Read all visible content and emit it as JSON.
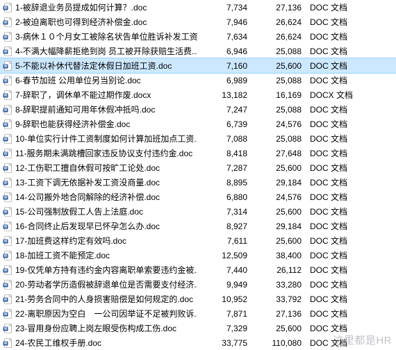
{
  "watermark": "这里都是HR",
  "rows": [
    {
      "icon": "doc",
      "name": "1-被辞退业务员提成如何计算？.doc",
      "val": "7,734",
      "size": "27,136",
      "type": "DOC 文档",
      "selected": false
    },
    {
      "icon": "doc",
      "name": "2-被迫离职也可得到经济补偿金.doc",
      "val": "7,946",
      "size": "26,624",
      "type": "DOC 文档",
      "selected": false
    },
    {
      "icon": "doc",
      "name": "3-病休１０个月女工被除名状告单位胜诉补发工资...",
      "val": "7,634",
      "size": "26,624",
      "type": "DOC 文档",
      "selected": false
    },
    {
      "icon": "doc",
      "name": "4-不满大幅降薪拒绝到岗 员工被开除获赔生活费....",
      "val": "6,946",
      "size": "25,088",
      "type": "DOC 文档",
      "selected": false
    },
    {
      "icon": "doc",
      "name": "5-不能以补休代替法定休假日加班工资.doc",
      "val": "7,160",
      "size": "25,600",
      "type": "DOC 文档",
      "selected": true
    },
    {
      "icon": "doc",
      "name": "6-春节加班 公用单位另当别论.doc",
      "val": "6,989",
      "size": "25,088",
      "type": "DOC 文档",
      "selected": false
    },
    {
      "icon": "docx",
      "name": "7-辞职了，调休单不能过期作废.docx",
      "val": "13,182",
      "size": "16,169",
      "type": "DOCX 文档",
      "selected": false
    },
    {
      "icon": "doc",
      "name": "8-辞职提前通知可用年休假冲抵吗.doc",
      "val": "7,247",
      "size": "25,088",
      "type": "DOC 文档",
      "selected": false
    },
    {
      "icon": "doc",
      "name": "9-辞职也能获得经济补偿金.doc",
      "val": "6,739",
      "size": "24,576",
      "type": "DOC 文档",
      "selected": false
    },
    {
      "icon": "doc",
      "name": "10-单位实行计件工资制度如何计算加班加点工资....",
      "val": "7,088",
      "size": "25,088",
      "type": "DOC 文档",
      "selected": false
    },
    {
      "icon": "doc",
      "name": "11-服务期未满跳槽回家违反协议支付违约金.doc",
      "val": "8,418",
      "size": "27,648",
      "type": "DOC 文档",
      "selected": false
    },
    {
      "icon": "doc",
      "name": "12-工伤职工擅自休假可按旷工论处.doc",
      "val": "7,287",
      "size": "25,600",
      "type": "DOC 文档",
      "selected": false
    },
    {
      "icon": "doc",
      "name": "13-工资下调无依据补发工资没商量.doc",
      "val": "8,895",
      "size": "29,184",
      "type": "DOC 文档",
      "selected": false
    },
    {
      "icon": "doc",
      "name": "14-公司搬外地合同解除的经济补偿.doc",
      "val": "6,880",
      "size": "24,576",
      "type": "DOC 文档",
      "selected": false
    },
    {
      "icon": "doc",
      "name": "15-公司强制放假工人告上法庭.doc",
      "val": "7,314",
      "size": "25,600",
      "type": "DOC 文档",
      "selected": false
    },
    {
      "icon": "doc",
      "name": "16-合同终止后发现早已怀孕怎么办.doc",
      "val": "8,927",
      "size": "29,184",
      "type": "DOC 文档",
      "selected": false
    },
    {
      "icon": "doc",
      "name": "17-加班费这样约定有效吗.doc",
      "val": "7,611",
      "size": "25,600",
      "type": "DOC 文档",
      "selected": false
    },
    {
      "icon": "doc",
      "name": "18-加班工资不能预定.doc",
      "val": "12,509",
      "size": "38,400",
      "type": "DOC 文档",
      "selected": false
    },
    {
      "icon": "doc",
      "name": "19-仅凭单方持有违约金内容离职单索要违约金被...",
      "val": "7,440",
      "size": "26,112",
      "type": "DOC 文档",
      "selected": false
    },
    {
      "icon": "doc",
      "name": "20-劳动者学历造假被辞退单位是否需要支付经济...",
      "val": "9,949",
      "size": "33,280",
      "type": "DOC 文档",
      "selected": false
    },
    {
      "icon": "doc",
      "name": "21-劳务合同中的人身损害赔偿是如何规定的.doc",
      "val": "10,952",
      "size": "33,792",
      "type": "DOC 文档",
      "selected": false
    },
    {
      "icon": "doc",
      "name": "22-离职原因为空白　一公司因举证不足被判败诉...",
      "val": "7,871",
      "size": "27,136",
      "type": "DOC 文档",
      "selected": false
    },
    {
      "icon": "doc",
      "name": "23-冒用身份应聘上岗左眼受伤构成工伤.doc",
      "val": "7,329",
      "size": "25,600",
      "type": "DOC 文档",
      "selected": false
    },
    {
      "icon": "doc",
      "name": "24-农民工维权手册.doc",
      "val": "33,775",
      "size": "110,080",
      "type": "DOC 文档",
      "selected": false
    }
  ]
}
